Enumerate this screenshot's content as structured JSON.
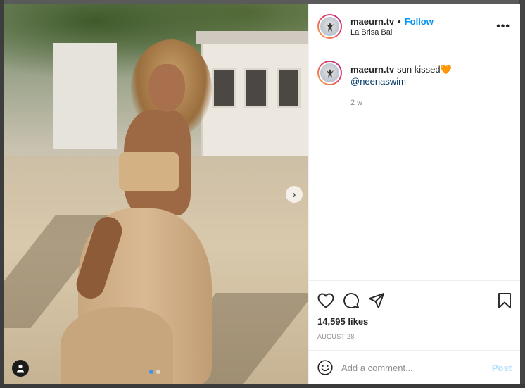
{
  "post": {
    "username": "maeurn.tv",
    "separator": "•",
    "follow_label": "Follow",
    "location": "La Brisa Bali",
    "more_label": "•••",
    "caption_text": "sun kissed",
    "caption_emoji": "🧡",
    "mention": "@neenaswim",
    "age": "2 w",
    "likes": "14,595 likes",
    "date": "AUGUST 28",
    "next_arrow": "›"
  },
  "comment_box": {
    "placeholder": "Add a comment...",
    "post_label": "Post"
  },
  "icons": {
    "like": "heart-icon",
    "comment": "comment-icon",
    "share": "share-icon",
    "save": "bookmark-icon",
    "emoji": "smiley-icon",
    "tag": "user-tag-icon"
  },
  "colors": {
    "accent": "#0095f6",
    "post_disabled": "#b2dffc",
    "text": "#262626",
    "muted": "#8e8e8e"
  }
}
